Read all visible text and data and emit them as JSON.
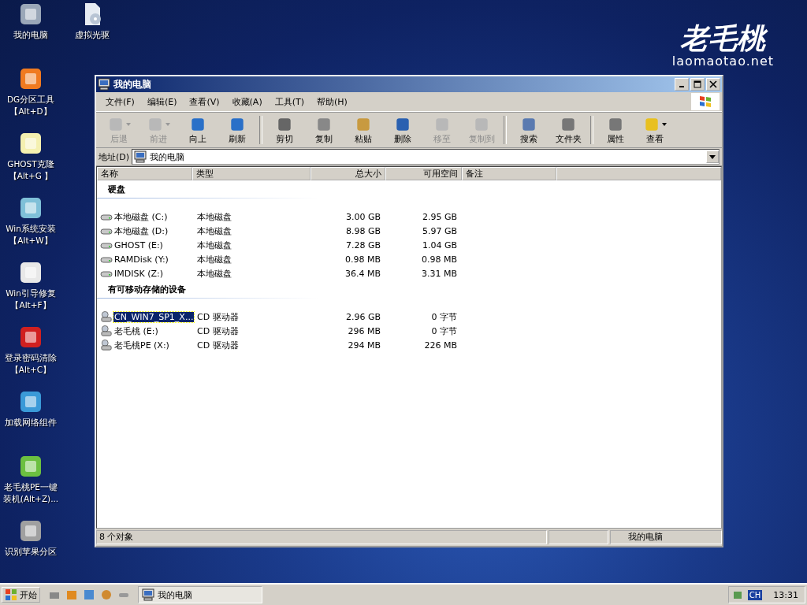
{
  "desktop": {
    "icons": [
      {
        "label": "我的电脑"
      },
      {
        "label": "虚拟光驱"
      },
      {
        "label": "DG分区工具",
        "hotkey": "【Alt+D】"
      },
      {
        "label": "GHOST克隆",
        "hotkey": "【Alt+G 】"
      },
      {
        "label": "Win系统安装",
        "hotkey": "【Alt+W】"
      },
      {
        "label": "Win引导修复",
        "hotkey": "【Alt+F】"
      },
      {
        "label": "登录密码清除",
        "hotkey": "【Alt+C】"
      },
      {
        "label": "加载网络组件"
      },
      {
        "label": "老毛桃PE一键装机(Alt+Z)..."
      },
      {
        "label": "识别苹果分区"
      }
    ],
    "logo": {
      "title": "老毛桃",
      "url": "laomaotao.net"
    }
  },
  "window": {
    "title": "我的电脑",
    "menu": [
      "文件(F)",
      "编辑(E)",
      "查看(V)",
      "收藏(A)",
      "工具(T)",
      "帮助(H)"
    ],
    "toolbar": {
      "groups": [
        [
          {
            "label": "后退",
            "disabled": true,
            "dropdown": true
          },
          {
            "label": "前进",
            "disabled": true,
            "dropdown": true
          },
          {
            "label": "向上",
            "disabled": false,
            "dropdown": false
          },
          {
            "label": "刷新",
            "disabled": false,
            "dropdown": false
          }
        ],
        [
          {
            "label": "剪切",
            "disabled": false,
            "dropdown": false
          },
          {
            "label": "复制",
            "disabled": false,
            "dropdown": false
          },
          {
            "label": "粘贴",
            "disabled": false,
            "dropdown": false
          },
          {
            "label": "删除",
            "disabled": false,
            "dropdown": false
          },
          {
            "label": "移至",
            "disabled": true,
            "dropdown": false
          },
          {
            "label": "复制到",
            "disabled": true,
            "dropdown": false
          }
        ],
        [
          {
            "label": "搜索",
            "disabled": false,
            "dropdown": false
          },
          {
            "label": "文件夹",
            "disabled": false,
            "dropdown": false
          }
        ],
        [
          {
            "label": "属性",
            "disabled": false,
            "dropdown": false
          },
          {
            "label": "查看",
            "disabled": false,
            "dropdown": true
          }
        ]
      ]
    },
    "address": {
      "label": "地址(D)",
      "value": "我的电脑"
    },
    "columns": [
      "名称",
      "类型",
      "总大小",
      "可用空间",
      "备注"
    ],
    "groups": [
      {
        "title": "硬盘",
        "rows": [
          {
            "kind": "disk",
            "name": "本地磁盘 (C:)",
            "type": "本地磁盘",
            "total": "3.00 GB",
            "free": "2.95 GB",
            "selected": false
          },
          {
            "kind": "disk",
            "name": "本地磁盘 (D:)",
            "type": "本地磁盘",
            "total": "8.98 GB",
            "free": "5.97 GB",
            "selected": false
          },
          {
            "kind": "disk",
            "name": "GHOST (E:)",
            "type": "本地磁盘",
            "total": "7.28 GB",
            "free": "1.04 GB",
            "selected": false
          },
          {
            "kind": "disk",
            "name": "RAMDisk (Y:)",
            "type": "本地磁盘",
            "total": "0.98 MB",
            "free": "0.98 MB",
            "selected": false
          },
          {
            "kind": "disk",
            "name": "IMDISK (Z:)",
            "type": "本地磁盘",
            "total": "36.4 MB",
            "free": "3.31 MB",
            "selected": false
          }
        ]
      },
      {
        "title": "有可移动存储的设备",
        "rows": [
          {
            "kind": "cd",
            "name": "CN_WIN7_SP1_X...",
            "type": "CD 驱动器",
            "total": "2.96 GB",
            "free": "0 字节",
            "selected": true
          },
          {
            "kind": "cd",
            "name": "老毛桃 (E:)",
            "type": "CD 驱动器",
            "total": "296 MB",
            "free": "0 字节",
            "selected": false
          },
          {
            "kind": "cd",
            "name": "老毛桃PE (X:)",
            "type": "CD 驱动器",
            "total": "294 MB",
            "free": "226 MB",
            "selected": false
          }
        ]
      }
    ],
    "status_bar": {
      "count": "8 个对象",
      "location": "我的电脑"
    }
  },
  "taskbar": {
    "start": "开始",
    "tasks": [
      {
        "label": "我的电脑"
      }
    ],
    "tray": {
      "ime": "CH",
      "clock": "13:31"
    }
  }
}
